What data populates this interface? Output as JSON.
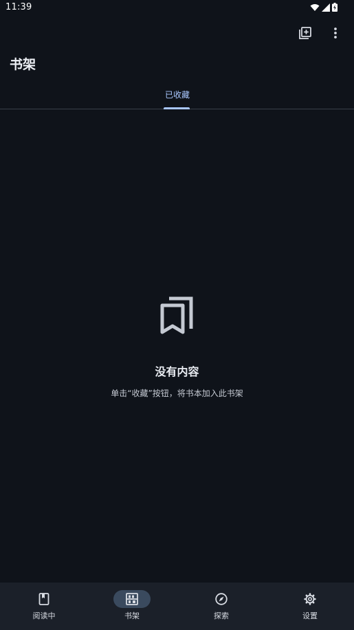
{
  "status_bar": {
    "time": "11:39"
  },
  "page": {
    "title": "书架"
  },
  "tabs": [
    {
      "label": "已收藏"
    }
  ],
  "empty_state": {
    "title": "没有内容",
    "description": "单击“收藏”按钮，将书本加入此书架"
  },
  "bottom_nav": [
    {
      "label": "阅读中",
      "icon": "book-icon"
    },
    {
      "label": "书架",
      "icon": "bookshelf-icon",
      "active": true
    },
    {
      "label": "探索",
      "icon": "compass-icon"
    },
    {
      "label": "设置",
      "icon": "gear-icon"
    }
  ],
  "colors": {
    "background": "#0f131a",
    "accent": "#a9c7ff",
    "nav_background": "#1b2029",
    "nav_active_pill": "#3a4a5e"
  }
}
